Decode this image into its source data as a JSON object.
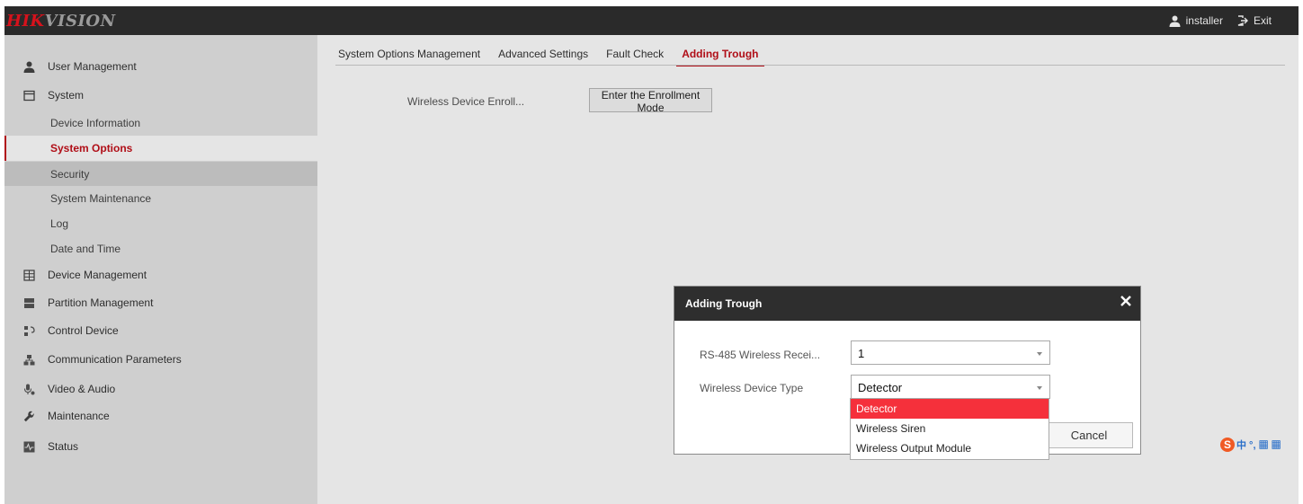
{
  "brand": {
    "logo_red": "HIK",
    "logo_gray": "VISION"
  },
  "header": {
    "user": "installer",
    "exit": "Exit",
    "user_icon": "person-icon",
    "exit_icon": "exit-icon"
  },
  "sidebar": {
    "items": [
      {
        "label": "User Management",
        "icon": "person-icon"
      },
      {
        "label": "System",
        "icon": "calendar-icon"
      },
      {
        "label": "Device Management",
        "icon": "grid-icon"
      },
      {
        "label": "Partition Management",
        "icon": "partition-icon"
      },
      {
        "label": "Control Device",
        "icon": "control-icon"
      },
      {
        "label": "Communication Parameters",
        "icon": "network-icon"
      },
      {
        "label": "Video & Audio",
        "icon": "mic-icon"
      },
      {
        "label": "Maintenance",
        "icon": "wrench-icon"
      },
      {
        "label": "Status",
        "icon": "status-icon"
      }
    ],
    "system_subitems": [
      "Device Information",
      "System Options",
      "Security",
      "System Maintenance",
      "Log",
      "Date and Time"
    ],
    "active_subitem": "System Options"
  },
  "tabs": [
    "System Options Management",
    "Advanced Settings",
    "Fault Check",
    "Adding Trough"
  ],
  "active_tab": "Adding Trough",
  "main": {
    "enroll_label": "Wireless Device Enroll...",
    "enroll_button": "Enter the Enrollment Mode"
  },
  "modal": {
    "title": "Adding Trough",
    "receiver_label": "RS-485 Wireless Recei...",
    "receiver_value": "1",
    "type_label": "Wireless Device Type",
    "type_value": "Detector",
    "type_options": [
      "Detector",
      "Wireless Siren",
      "Wireless Output Module"
    ],
    "cancel": "Cancel"
  },
  "ime": {
    "glyphs": "中 °, ▦ ▦"
  },
  "colors": {
    "accent": "#c5101a",
    "topbar": "#2a2a2a",
    "selected_option": "#f5303b"
  }
}
